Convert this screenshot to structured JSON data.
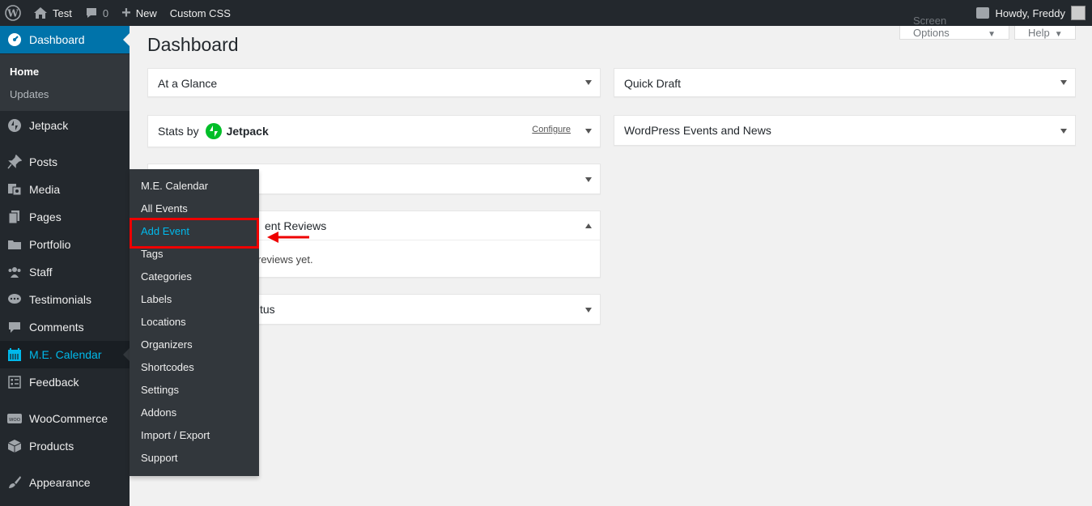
{
  "adminbar": {
    "site_name": "Test",
    "comments_count": "0",
    "new_label": "New",
    "custom_css": "Custom CSS",
    "howdy": "Howdy, Freddy"
  },
  "sidebar": {
    "dashboard": "Dashboard",
    "home": "Home",
    "updates": "Updates",
    "jetpack": "Jetpack",
    "posts": "Posts",
    "media": "Media",
    "pages": "Pages",
    "portfolio": "Portfolio",
    "staff": "Staff",
    "testimonials": "Testimonials",
    "comments": "Comments",
    "me_calendar": "M.E. Calendar",
    "feedback": "Feedback",
    "woocommerce": "WooCommerce",
    "products": "Products",
    "appearance": "Appearance"
  },
  "flyout": {
    "items": [
      "M.E. Calendar",
      "All Events",
      "Add Event",
      "Tags",
      "Categories",
      "Labels",
      "Locations",
      "Organizers",
      "Shortcodes",
      "Settings",
      "Addons",
      "Import / Export",
      "Support"
    ]
  },
  "page": {
    "title": "Dashboard",
    "screen_options": "Screen Options",
    "help": "Help"
  },
  "widgets": {
    "at_a_glance": "At a Glance",
    "stats_prefix": "Stats by",
    "jetpack_brand": "Jetpack",
    "configure": "Configure",
    "event_reviews_partial": "ent Reviews",
    "reviews_body_partial": "reviews yet.",
    "status_partial": "tus",
    "quick_draft": "Quick Draft",
    "events_news": "WordPress Events and News"
  },
  "colors": {
    "accent": "#0073aa",
    "highlight": "#00b9eb",
    "callout": "#e00000",
    "jetpack_green": "#00be28"
  }
}
